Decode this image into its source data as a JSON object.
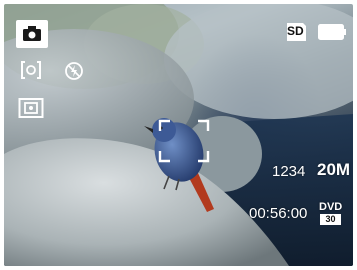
{
  "viewfinder": {
    "shot_count": "1234",
    "resolution": "20M",
    "record_time": "00:56:00",
    "quality_badge_top": "DVD",
    "quality_badge_bottom": "30",
    "sd_label": "SD"
  },
  "icons": {
    "mode": "camera-mode-icon",
    "af": "af-area-icon",
    "flash": "flash-off-icon",
    "metering": "metering-icon",
    "sd": "sd-card-icon",
    "battery": "battery-full-icon",
    "focus": "focus-frame-icon"
  },
  "colors": {
    "hud": "#ffffff",
    "mode_highlight": "#ffffff",
    "mode_icon": "#1a1a1a"
  }
}
